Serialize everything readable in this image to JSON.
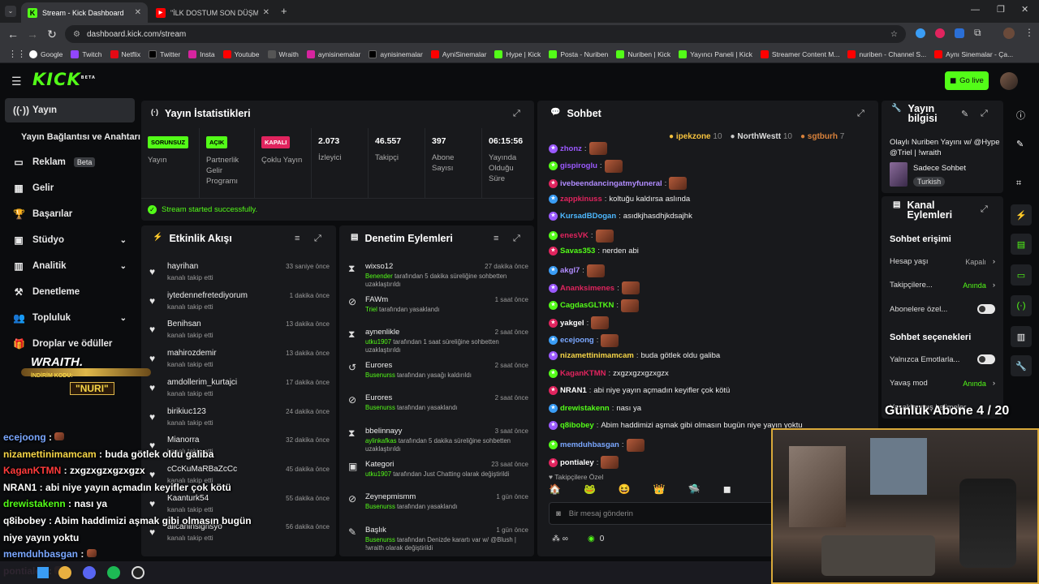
{
  "browser": {
    "tabs": [
      {
        "title": "Stream - Kick Dashboard"
      },
      {
        "title": "\"İLK DOSTUM SON DÜŞMANIM"
      }
    ],
    "url": "dashboard.kick.com/stream",
    "bookmarks": [
      "Google",
      "Twitch",
      "Netflix",
      "Twitter",
      "Insta",
      "Youtube",
      "Wraith",
      "aynisinemalar",
      "aynisinemalar",
      "AyniSinemalar",
      "Hype | Kick",
      "Posta - Nuriben",
      "Nuriben | Kick",
      "Yayıncı Paneli | Kick",
      "Streamer Content M...",
      "nuriben - Channel S...",
      "Aynı Sinemalar - Ça..."
    ]
  },
  "header": {
    "logo": "KICK",
    "logo_sup": "BETA",
    "go_live": "Go live"
  },
  "sidebar": [
    {
      "label": "Yayın",
      "icon": "broadcast-icon"
    },
    {
      "label": "Yayın Bağlantısı ve Anahtarı",
      "icon": ""
    },
    {
      "label": "Reklam",
      "icon": "ad-icon",
      "badge": "Beta"
    },
    {
      "label": "Gelir",
      "icon": "income-icon"
    },
    {
      "label": "Başarılar",
      "icon": "trophy-icon"
    },
    {
      "label": "Stüdyo",
      "icon": "studio-icon"
    },
    {
      "label": "Analitik",
      "icon": "analytics-icon"
    },
    {
      "label": "Denetleme",
      "icon": "moderation-icon"
    },
    {
      "label": "Topluluk",
      "icon": "community-icon"
    },
    {
      "label": "Droplar ve ödüller",
      "icon": "gift-icon"
    }
  ],
  "stats": {
    "title": "Yayın İstatistikleri",
    "items": [
      {
        "badge": "SORUNSUZ",
        "label": "Yayın"
      },
      {
        "badge": "AÇIK",
        "label": "Partnerlik Gelir Programı"
      },
      {
        "badge": "KAPALI",
        "label": "Çoklu Yayın"
      },
      {
        "value": "2.073",
        "label": "İzleyici"
      },
      {
        "value": "46.557",
        "label": "Takipçi"
      },
      {
        "value": "397",
        "label": "Abone Sayısı"
      },
      {
        "value": "06:15:56",
        "label": "Yayında Olduğu Süre"
      }
    ],
    "success": "Stream started successfully."
  },
  "activity": {
    "title": "Etkinlik Akışı",
    "items": [
      {
        "name": "hayrihan",
        "sub": "kanalı takip etti",
        "time": "33 saniye önce"
      },
      {
        "name": "iytedennefretediyorum",
        "sub": "kanalı takip etti",
        "time": "1 dakika önce"
      },
      {
        "name": "Benihsan",
        "sub": "kanalı takip etti",
        "time": "13 dakika önce"
      },
      {
        "name": "mahirozdemir",
        "sub": "kanalı takip etti",
        "time": "13 dakika önce"
      },
      {
        "name": "amdollerim_kurtajci",
        "sub": "kanalı takip etti",
        "time": "17 dakika önce"
      },
      {
        "name": "birikiuc123",
        "sub": "kanalı takip etti",
        "time": "24 dakika önce"
      },
      {
        "name": "Mianorra",
        "sub": "kanalı takip etti",
        "time": "32 dakika önce"
      },
      {
        "name": "cCcKuMaRBaZcCc",
        "sub": "kanalı takip etti",
        "time": "45 dakika önce"
      },
      {
        "name": "Kaanturk54",
        "sub": "kanalı takip etti",
        "time": "55 dakika önce"
      },
      {
        "name": "alicaninsignsyo",
        "sub": "kanalı takip etti",
        "time": "56 dakika önce"
      }
    ]
  },
  "moderation": {
    "title": "Denetim Eylemleri",
    "items": [
      {
        "icon": "hourglass-icon",
        "name": "wixso12",
        "actor": "Benender",
        "rest": "tarafından 5 dakika süreliğine sohbetten uzaklaştırıldı",
        "time": "27 dakika önce"
      },
      {
        "icon": "ban-icon",
        "name": "FAWm",
        "actor": "Triel",
        "rest": "tarafından yasaklandı",
        "time": "1 saat önce"
      },
      {
        "icon": "hourglass-icon",
        "name": "aynenlikle",
        "actor": "utku1907",
        "rest": "tarafından 1 saat süreliğine sohbetten uzaklaştırıldı",
        "time": "2 saat önce"
      },
      {
        "icon": "undo-icon",
        "name": "Eurores",
        "actor": "Busenurss",
        "rest": "tarafından yasağı kaldırıldı",
        "time": "2 saat önce"
      },
      {
        "icon": "ban-icon",
        "name": "Eurores",
        "actor": "Busenurss",
        "rest": "tarafından yasaklandı",
        "time": "2 saat önce"
      },
      {
        "icon": "hourglass-icon",
        "name": "bbelinnayy",
        "actor": "aylinkafkas",
        "rest": "tarafından 5 dakika süreliğine sohbetten uzaklaştırıldı",
        "time": "3 saat önce"
      },
      {
        "icon": "category-icon",
        "name": "Kategori",
        "actor": "utku1907",
        "rest": "tarafından Just Chatting olarak değiştirildi",
        "time": "23 saat önce"
      },
      {
        "icon": "ban-icon",
        "name": "Zeynepmismm",
        "actor": "Busenurss",
        "rest": "tarafından yasaklandı",
        "time": "1 gün önce"
      },
      {
        "icon": "title-icon",
        "name": "Başlık",
        "actor": "Busenurss",
        "rest": "tarafından Denizde karartı var w/ @Blush | !wraith olarak değiştirildi",
        "time": "1 gün önce"
      }
    ]
  },
  "chat": {
    "title": "Sohbet",
    "top": [
      {
        "name": "ipekzone",
        "count": "10"
      },
      {
        "name": "NorthWestt",
        "count": "10"
      },
      {
        "name": "sgtburh",
        "count": "7"
      }
    ],
    "messages": [
      {
        "user": "zhonz",
        "color": "#9b59ff",
        "text": ""
      },
      {
        "user": "gispiroglu",
        "color": "#9b59ff",
        "text": ""
      },
      {
        "user": "ivebeendancingatmyfuneral",
        "color": "#b18cff",
        "text": ""
      },
      {
        "user": "zappkinuss",
        "color": "#e0245e",
        "text": "koltuğu kaldırsa aslında"
      },
      {
        "user": "KursadBDogan",
        "color": "#4db8ff",
        "text": "asıdkjhasdhjkdsajhk"
      },
      {
        "user": "enesVK",
        "color": "#e0245e",
        "text": ""
      },
      {
        "user": "Savas353",
        "color": "#53fc18",
        "text": "nerden abi"
      },
      {
        "user": "akgl7",
        "color": "#b18cff",
        "text": ""
      },
      {
        "user": "Ananksimenes",
        "color": "#e0245e",
        "text": ""
      },
      {
        "user": "CagdasGLTKN",
        "color": "#53fc18",
        "text": ""
      },
      {
        "user": "yakgel",
        "color": "#ffffff",
        "text": ""
      },
      {
        "user": "ecejoong",
        "color": "#7aa7ff",
        "text": ""
      },
      {
        "user": "nizamettinimamcam",
        "color": "#f6d547",
        "text": "buda götlek oldu galiba"
      },
      {
        "user": "KaganKTMN",
        "color": "#e0245e",
        "text": "zxgzxgzxgzxgzx"
      },
      {
        "user": "NRAN1",
        "color": "#ffffff",
        "text": "abi niye yayın açmadın keyifler çok kötü"
      },
      {
        "user": "drewistakenn",
        "color": "#53fc18",
        "text": "nası ya"
      },
      {
        "user": "q8ibobey",
        "color": "#53fc18",
        "text": "Abim haddimizi aşmak gibi olmasın bugün niye yayın yoktu"
      },
      {
        "user": "memduhbasgan",
        "color": "#7aa7ff",
        "text": ""
      },
      {
        "user": "pontialey",
        "color": "#ffffff",
        "text": ""
      }
    ],
    "followers_label": "Takipçilere Özel",
    "input_placeholder": "Bir mesaj gönderin",
    "points": "0"
  },
  "info": {
    "title": "Yayın bilgisi",
    "stream_title": "Olaylı Nuriben Yayını w/ @Hype @Triel | !wraith",
    "category": "Sadece Sohbet",
    "language": "Turkish",
    "actions_title": "Kanal Eylemleri",
    "chat_access": "Sohbet erişimi",
    "rows": [
      {
        "label": "Hesap yaşı",
        "value": "Kapalı"
      },
      {
        "label": "Takipçilere...",
        "value": "Anında"
      },
      {
        "label": "Abonelere özel...",
        "toggle": true
      }
    ],
    "chat_options": "Sohbet seçenekleri",
    "rows2": [
      {
        "label": "Yalnızca Emotlarla...",
        "toggle": true
      },
      {
        "label": "Yavaş mod",
        "value": "Anında"
      },
      {
        "label": "Yasaklanmış kelimeler",
        "value": ""
      }
    ]
  },
  "overlay": {
    "sponsor": "WRAITH.",
    "code_label": "İNDİRİM KODU:",
    "code": "NURI",
    "goal": "Günlük Abone 4 / 20",
    "chat": [
      {
        "user": "ecejoong",
        "color": "#7aa7ff",
        "text": ""
      },
      {
        "user": "nizamettinimamcam",
        "color": "#f6d547",
        "text": "buda götlek oldu galiba"
      },
      {
        "user": "KaganKTMN",
        "color": "#ff3b3b",
        "text": "zxgzxgzxgzxgzx"
      },
      {
        "user": "NRAN1",
        "color": "#ffffff",
        "text": "abi niye yayın açmadın keyifler çok kötü"
      },
      {
        "user": "drewistakenn",
        "color": "#53fc18",
        "text": "nası ya"
      },
      {
        "user": "q8ibobey",
        "color": "#ffffff",
        "text": "Abim haddimizi aşmak gibi olmasın bugün"
      },
      {
        "user": "",
        "color": "#ffffff",
        "text": "niye yayın yoktu"
      },
      {
        "user": "memduhbasgan",
        "color": "#7aa7ff",
        "text": ""
      },
      {
        "user": "pontialey",
        "color": "#ff8ad4",
        "text": ""
      }
    ]
  }
}
